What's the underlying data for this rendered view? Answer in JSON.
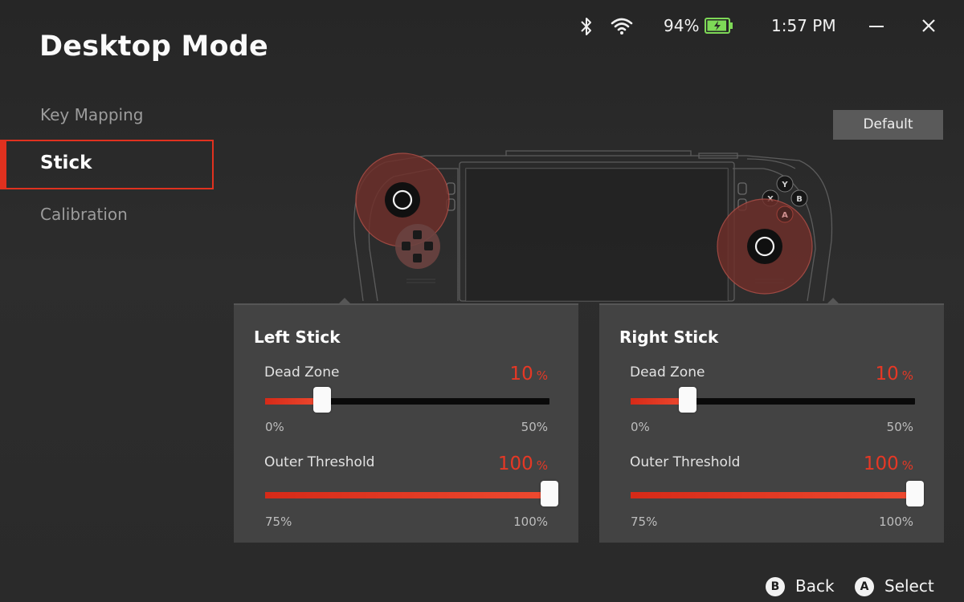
{
  "app": {
    "title": "Desktop Mode"
  },
  "status": {
    "battery_percent": "94%",
    "time": "1:57 PM",
    "battery_level": 0.94
  },
  "sidebar": {
    "items": [
      {
        "label": "Key Mapping",
        "active": false
      },
      {
        "label": "Stick",
        "active": true
      },
      {
        "label": "Calibration",
        "active": false
      }
    ]
  },
  "toolbar": {
    "default_label": "Default"
  },
  "device": {
    "face_buttons": [
      "Y",
      "X",
      "B",
      "A"
    ]
  },
  "left_stick": {
    "title": "Left Stick",
    "dead_zone": {
      "label": "Dead Zone",
      "value": "10",
      "unit": "%",
      "min_label": "0%",
      "max_label": "50%",
      "fraction": 0.2
    },
    "outer_threshold": {
      "label": "Outer Threshold",
      "value": "100",
      "unit": "%",
      "min_label": "75%",
      "max_label": "100%",
      "fraction": 1.0
    }
  },
  "right_stick": {
    "title": "Right Stick",
    "dead_zone": {
      "label": "Dead Zone",
      "value": "10",
      "unit": "%",
      "min_label": "0%",
      "max_label": "50%",
      "fraction": 0.2
    },
    "outer_threshold": {
      "label": "Outer Threshold",
      "value": "100",
      "unit": "%",
      "min_label": "75%",
      "max_label": "100%",
      "fraction": 1.0
    }
  },
  "footer": {
    "back": {
      "glyph": "B",
      "label": "Back"
    },
    "select": {
      "glyph": "A",
      "label": "Select"
    }
  },
  "colors": {
    "accent": "#e0311f",
    "battery": "#7ed957",
    "panel": "#434343",
    "background": "#2a2a2a"
  }
}
